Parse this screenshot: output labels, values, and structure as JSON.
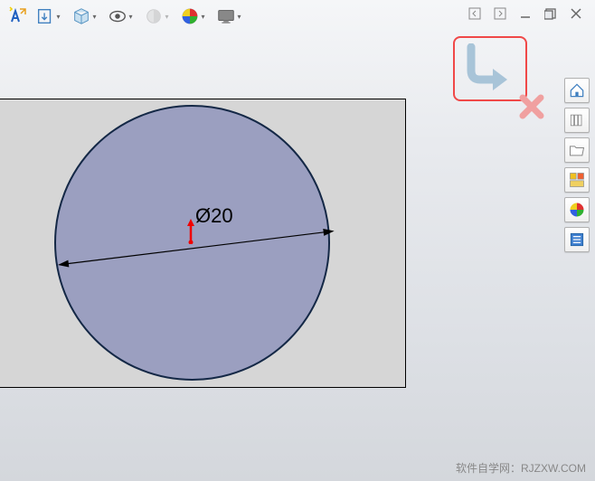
{
  "toolbar": {
    "buttons": [
      "rebuild",
      "import",
      "cube",
      "visibility",
      "section",
      "appearance",
      "display"
    ]
  },
  "sketch": {
    "dimension_label": "Ø20"
  },
  "watermark": "软件自学网：RJZXW.COM",
  "highlight": {
    "tooltip": "exit-sketch"
  }
}
